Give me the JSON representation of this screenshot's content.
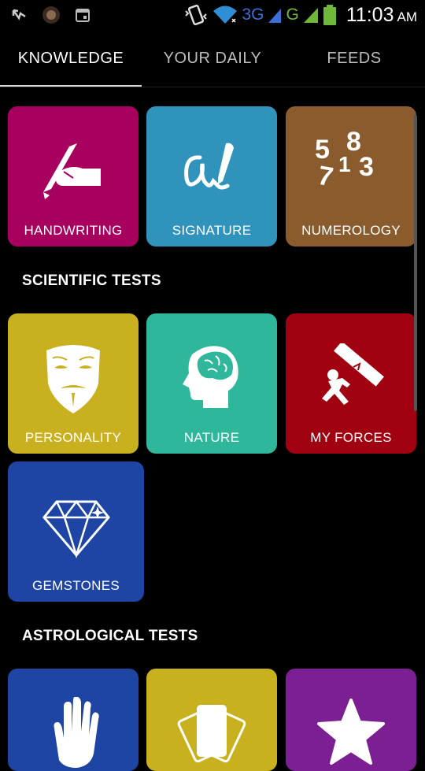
{
  "status_bar": {
    "network_3g": "3G",
    "network_g": "G",
    "time": "11:03",
    "ampm": "AM"
  },
  "tabs": [
    {
      "label": "KNOWLEDGE",
      "active": true
    },
    {
      "label": "YOUR DAILY",
      "active": false
    },
    {
      "label": "FEEDS",
      "active": false
    }
  ],
  "tiles": {
    "handwriting": {
      "label": "HANDWRITING",
      "color": "#a8005e"
    },
    "signature": {
      "label": "SIGNATURE",
      "color": "#2f93bb"
    },
    "numerology": {
      "label": "NUMEROLOGY",
      "color": "#8a5b2c",
      "digits": [
        "5",
        "8",
        "7",
        "1",
        "3"
      ]
    },
    "personality": {
      "label": "PERSONALITY",
      "color": "#c9b01f"
    },
    "nature": {
      "label": "NATURE",
      "color": "#2eb79a"
    },
    "my_forces": {
      "label": "MY FORCES",
      "color": "#a10010"
    },
    "gemstones": {
      "label": "GEMSTONES",
      "color": "#1e45a4"
    },
    "palm": {
      "color": "#1e45a4"
    },
    "cards": {
      "color": "#c9b01f"
    },
    "star": {
      "color": "#7b1f93"
    }
  },
  "sections": {
    "scientific": "SCIENTIFIC TESTS",
    "astrological": "ASTROLOGICAL TESTS"
  }
}
